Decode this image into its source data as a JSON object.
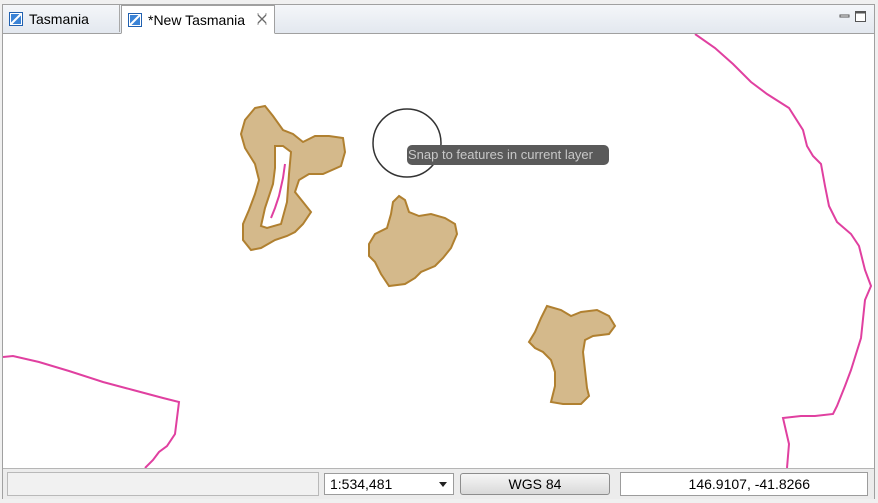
{
  "tabs": [
    {
      "label": "Tasmania",
      "active": false,
      "icon": "map-icon"
    },
    {
      "label": "*New Tasmania",
      "active": true,
      "icon": "map-icon"
    }
  ],
  "window_controls": {
    "minimize_icon": "minimize-icon",
    "maximize_icon": "maximize-icon"
  },
  "map": {
    "tooltip": "Snap to features in current layer",
    "colors": {
      "feature_fill": "#d4b98b",
      "feature_stroke": "#b08030",
      "boundary_line": "#e040a0",
      "cursor_circle": "#333333"
    }
  },
  "status": {
    "scale": "1:534,481",
    "crs": "WGS 84",
    "coordinates": "146.9107, -41.8266"
  }
}
